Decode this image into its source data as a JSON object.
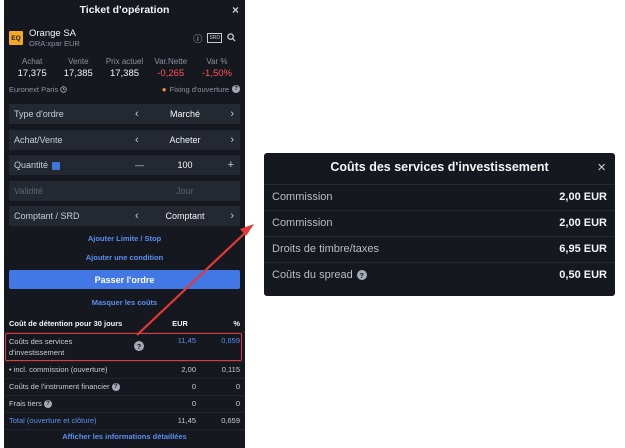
{
  "ticket": {
    "title": "Ticket d'opération",
    "close_glyph": "×",
    "instrument": {
      "badge": "EQ",
      "name": "Orange SA",
      "sub": "ORA:xpar EUR",
      "icon_srd": "SRD",
      "icon_info": "ⓘ",
      "icon_search": "⚲"
    },
    "prices": [
      {
        "label": "Achat",
        "value": "17,375",
        "negative": false
      },
      {
        "label": "Vente",
        "value": "17,385",
        "negative": false
      },
      {
        "label": "Prix actuel",
        "value": "17,385",
        "negative": false
      },
      {
        "label": "Var.Nette",
        "value": "-0,265",
        "negative": true
      },
      {
        "label": "Var %",
        "value": "-1,50%",
        "negative": true
      }
    ],
    "market": "Euronext Paris",
    "fixing": "Fixing d'ouverture",
    "fields": {
      "order_type": {
        "label": "Type d'ordre",
        "value": "Marché"
      },
      "side": {
        "label": "Achat/Vente",
        "value": "Acheter"
      },
      "quantity": {
        "label": "Quantité",
        "value": "100",
        "minus": "—",
        "plus": "+"
      },
      "validity": {
        "label": "Validité",
        "value": "Jour"
      },
      "settlement": {
        "label": "Comptant / SRD",
        "value": "Comptant"
      }
    },
    "links": {
      "add_limit": "Ajouter Limite / Stop",
      "add_condition": "Ajouter une condition",
      "hide_costs": "Masquer les coûts",
      "show_details": "Afficher les informations détaillées"
    },
    "submit_label": "Passer l'ordre",
    "costs": {
      "header": {
        "label": "Coût de détention pour 30 jours",
        "col1": "EUR",
        "col2": "%"
      },
      "rows": [
        {
          "label": "Coûts des services d'investissement",
          "eur": "11,45",
          "pct": "0,659"
        },
        {
          "label": "• incl. commission (ouverture)",
          "eur": "2,00",
          "pct": "0,115"
        },
        {
          "label": "Coûts de l'instrument financier",
          "eur": "0",
          "pct": "0"
        },
        {
          "label": "Frais tiers",
          "eur": "0",
          "pct": "0"
        },
        {
          "label": "Total (ouverture et clôture)",
          "eur": "11,45",
          "pct": "0,659"
        }
      ]
    }
  },
  "popup": {
    "title": "Coûts des services d'investissement",
    "close_glyph": "×",
    "rows": [
      {
        "label": "Commission",
        "value": "2,00 EUR"
      },
      {
        "label": "Commission",
        "value": "2,00 EUR"
      },
      {
        "label": "Droits de timbre/taxes",
        "value": "6,95 EUR"
      },
      {
        "label": "Coûts du spread",
        "value": "0,50 EUR"
      }
    ]
  },
  "colors": {
    "panel_bg": "#15181e",
    "field_bg": "#242831",
    "accent": "#4277e6",
    "link": "#5b8ff0",
    "negative": "#ff5656",
    "highlight": "#e53935"
  }
}
